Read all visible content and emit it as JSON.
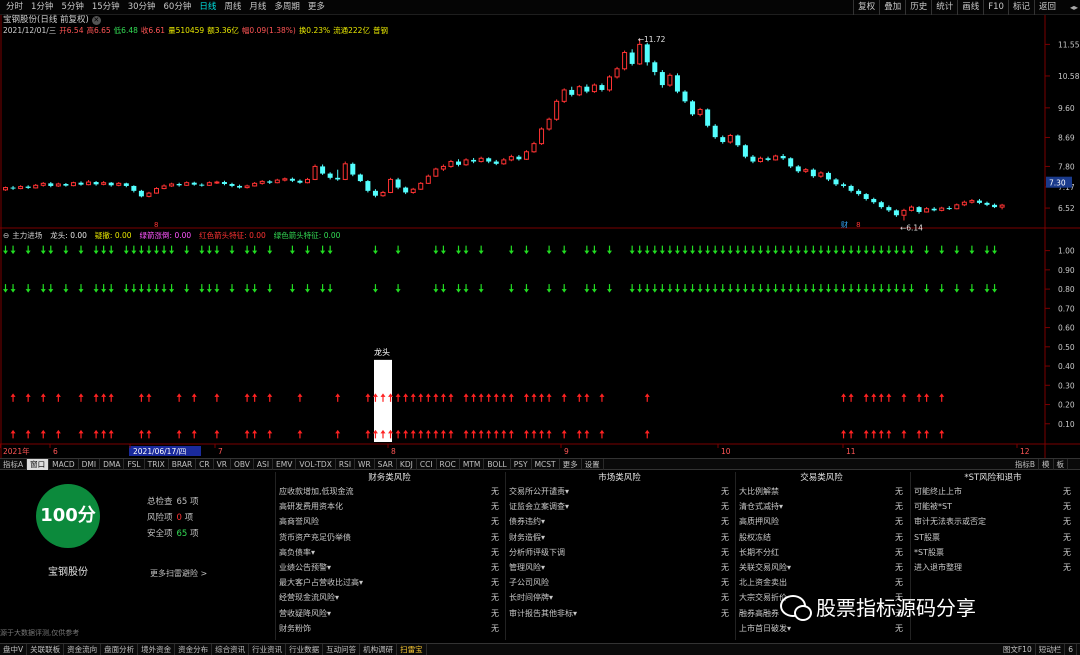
{
  "toolbar": {
    "timeframes": [
      "分时",
      "1分钟",
      "5分钟",
      "15分钟",
      "30分钟",
      "60分钟",
      "日线",
      "周线",
      "月线",
      "多周期",
      "更多"
    ],
    "active_timeframe": "日线",
    "right_buttons": [
      "复权",
      "叠加",
      "历史",
      "统计",
      "画线",
      "F10",
      "标记",
      "返回"
    ],
    "scroll_arrows": "◂▸"
  },
  "stock": {
    "title": "宝钢股份(日线 前复权)",
    "close_icon": "close-icon"
  },
  "info_bar": {
    "date": "2021/12/01/三",
    "open": "开6.54",
    "high": "高6.65",
    "low": "低6.48",
    "close": "收6.61",
    "volume": "量510459",
    "amount": "额3.36亿",
    "change": "幅0.09(1.38%)",
    "turnover": "换0.23%",
    "float_shares": "流通222亿",
    "sector": "普钢"
  },
  "price_axis": {
    "ticks": [
      "11.55",
      "10.58",
      "9.60",
      "8.69",
      "7.80",
      "7.17",
      "6.52"
    ],
    "current_price_tag": "7.30"
  },
  "chart_data": {
    "type": "candlestick",
    "y_range": [
      6.0,
      11.9
    ],
    "candles": [
      [
        7.08,
        7.15,
        7.18,
        7.05
      ],
      [
        7.15,
        7.12,
        7.2,
        7.08
      ],
      [
        7.12,
        7.18,
        7.22,
        7.1
      ],
      [
        7.18,
        7.14,
        7.22,
        7.11
      ],
      [
        7.14,
        7.22,
        7.26,
        7.12
      ],
      [
        7.22,
        7.28,
        7.32,
        7.18
      ],
      [
        7.28,
        7.2,
        7.32,
        7.16
      ],
      [
        7.2,
        7.26,
        7.3,
        7.17
      ],
      [
        7.26,
        7.21,
        7.29,
        7.18
      ],
      [
        7.21,
        7.3,
        7.33,
        7.19
      ],
      [
        7.3,
        7.24,
        7.34,
        7.21
      ],
      [
        7.24,
        7.32,
        7.38,
        7.22
      ],
      [
        7.32,
        7.25,
        7.35,
        7.21
      ],
      [
        7.25,
        7.3,
        7.35,
        7.22
      ],
      [
        7.3,
        7.22,
        7.32,
        7.18
      ],
      [
        7.22,
        7.28,
        7.32,
        7.19
      ],
      [
        7.28,
        7.2,
        7.3,
        7.16
      ],
      [
        7.2,
        7.05,
        7.22,
        7.0
      ],
      [
        7.05,
        6.88,
        7.08,
        6.85
      ],
      [
        6.88,
        6.98,
        7.02,
        6.85
      ],
      [
        6.98,
        7.12,
        7.16,
        6.96
      ],
      [
        7.12,
        7.2,
        7.25,
        7.1
      ],
      [
        7.2,
        7.26,
        7.3,
        7.17
      ],
      [
        7.26,
        7.22,
        7.3,
        7.18
      ],
      [
        7.22,
        7.3,
        7.34,
        7.2
      ],
      [
        7.3,
        7.24,
        7.33,
        7.21
      ],
      [
        7.24,
        7.22,
        7.28,
        7.18
      ],
      [
        7.22,
        7.3,
        7.34,
        7.2
      ],
      [
        7.3,
        7.32,
        7.36,
        7.26
      ],
      [
        7.32,
        7.26,
        7.36,
        7.22
      ],
      [
        7.26,
        7.2,
        7.3,
        7.16
      ],
      [
        7.2,
        7.15,
        7.24,
        7.12
      ],
      [
        7.15,
        7.2,
        7.24,
        7.12
      ],
      [
        7.2,
        7.28,
        7.32,
        7.18
      ],
      [
        7.28,
        7.34,
        7.38,
        7.24
      ],
      [
        7.34,
        7.3,
        7.38,
        7.26
      ],
      [
        7.3,
        7.38,
        7.42,
        7.28
      ],
      [
        7.38,
        7.42,
        7.46,
        7.34
      ],
      [
        7.42,
        7.36,
        7.46,
        7.32
      ],
      [
        7.36,
        7.3,
        7.4,
        7.27
      ],
      [
        7.3,
        7.4,
        7.45,
        7.28
      ],
      [
        7.4,
        7.8,
        7.86,
        7.38
      ],
      [
        7.8,
        7.58,
        7.86,
        7.54
      ],
      [
        7.58,
        7.45,
        7.62,
        7.4
      ],
      [
        7.45,
        7.4,
        7.7,
        7.36
      ],
      [
        7.4,
        7.88,
        7.95,
        7.38
      ],
      [
        7.88,
        7.55,
        7.92,
        7.5
      ],
      [
        7.55,
        7.35,
        7.58,
        7.32
      ],
      [
        7.35,
        7.05,
        7.38,
        7.0
      ],
      [
        7.05,
        6.9,
        7.1,
        6.85
      ],
      [
        6.9,
        7.0,
        7.05,
        6.87
      ],
      [
        7.0,
        7.4,
        7.45,
        6.98
      ],
      [
        7.4,
        7.15,
        7.45,
        7.1
      ],
      [
        7.15,
        7.0,
        7.18,
        6.95
      ],
      [
        7.0,
        7.1,
        7.14,
        6.96
      ],
      [
        7.1,
        7.28,
        7.32,
        7.08
      ],
      [
        7.28,
        7.5,
        7.55,
        7.26
      ],
      [
        7.5,
        7.72,
        7.76,
        7.48
      ],
      [
        7.72,
        7.8,
        7.86,
        7.66
      ],
      [
        7.8,
        7.95,
        8.0,
        7.76
      ],
      [
        7.95,
        7.85,
        8.02,
        7.8
      ],
      [
        7.85,
        8.0,
        8.05,
        7.82
      ],
      [
        8.0,
        7.95,
        8.06,
        7.9
      ],
      [
        7.95,
        8.05,
        8.1,
        7.92
      ],
      [
        8.05,
        7.95,
        8.08,
        7.9
      ],
      [
        7.95,
        7.88,
        8.0,
        7.84
      ],
      [
        7.88,
        8.0,
        8.06,
        7.85
      ],
      [
        8.0,
        8.1,
        8.16,
        7.96
      ],
      [
        8.1,
        8.02,
        8.15,
        7.98
      ],
      [
        8.02,
        8.25,
        8.3,
        8.0
      ],
      [
        8.25,
        8.5,
        8.56,
        8.22
      ],
      [
        8.5,
        8.95,
        9.0,
        8.46
      ],
      [
        8.95,
        9.25,
        9.3,
        8.9
      ],
      [
        9.25,
        9.8,
        9.86,
        9.2
      ],
      [
        9.8,
        10.15,
        10.2,
        9.75
      ],
      [
        10.15,
        10.0,
        10.25,
        9.95
      ],
      [
        10.0,
        10.25,
        10.3,
        9.96
      ],
      [
        10.25,
        10.1,
        10.32,
        10.05
      ],
      [
        10.1,
        10.3,
        10.35,
        10.06
      ],
      [
        10.3,
        10.15,
        10.35,
        10.1
      ],
      [
        10.15,
        10.55,
        10.6,
        10.1
      ],
      [
        10.55,
        10.8,
        10.86,
        10.5
      ],
      [
        10.8,
        11.3,
        11.36,
        10.75
      ],
      [
        11.3,
        10.95,
        11.4,
        10.9
      ],
      [
        10.95,
        11.55,
        11.72,
        10.92
      ],
      [
        11.55,
        11.0,
        11.6,
        10.9
      ],
      [
        11.0,
        10.7,
        11.05,
        10.6
      ],
      [
        10.7,
        10.3,
        10.76,
        10.22
      ],
      [
        10.3,
        10.6,
        10.66,
        10.25
      ],
      [
        10.6,
        10.1,
        10.66,
        10.05
      ],
      [
        10.1,
        9.8,
        10.14,
        9.75
      ],
      [
        9.8,
        9.4,
        9.84,
        9.35
      ],
      [
        9.4,
        9.55,
        9.6,
        9.34
      ],
      [
        9.55,
        9.05,
        9.58,
        9.0
      ],
      [
        9.05,
        8.7,
        9.1,
        8.65
      ],
      [
        8.7,
        8.55,
        8.75,
        8.5
      ],
      [
        8.55,
        8.75,
        8.8,
        8.5
      ],
      [
        8.75,
        8.45,
        8.78,
        8.4
      ],
      [
        8.45,
        8.1,
        8.48,
        8.05
      ],
      [
        8.1,
        7.95,
        8.15,
        7.9
      ],
      [
        7.95,
        8.05,
        8.1,
        7.92
      ],
      [
        8.05,
        8.0,
        8.1,
        7.96
      ],
      [
        8.0,
        8.12,
        8.16,
        7.98
      ],
      [
        8.12,
        8.05,
        8.18,
        8.0
      ],
      [
        8.05,
        7.8,
        8.08,
        7.75
      ],
      [
        7.8,
        7.65,
        7.84,
        7.6
      ],
      [
        7.65,
        7.7,
        7.75,
        7.6
      ],
      [
        7.7,
        7.5,
        7.74,
        7.45
      ],
      [
        7.5,
        7.6,
        7.65,
        7.45
      ],
      [
        7.6,
        7.4,
        7.64,
        7.35
      ],
      [
        7.4,
        7.25,
        7.44,
        7.2
      ],
      [
        7.25,
        7.2,
        7.3,
        7.15
      ],
      [
        7.2,
        7.05,
        7.24,
        7.0
      ],
      [
        7.05,
        6.95,
        7.1,
        6.9
      ],
      [
        6.95,
        6.8,
        6.98,
        6.75
      ],
      [
        6.8,
        6.7,
        6.84,
        6.65
      ],
      [
        6.7,
        6.55,
        6.74,
        6.5
      ],
      [
        6.55,
        6.45,
        6.6,
        6.4
      ],
      [
        6.45,
        6.3,
        6.48,
        6.25
      ],
      [
        6.3,
        6.45,
        6.5,
        6.14
      ],
      [
        6.45,
        6.55,
        6.6,
        6.42
      ],
      [
        6.55,
        6.4,
        6.58,
        6.35
      ],
      [
        6.4,
        6.5,
        6.55,
        6.38
      ],
      [
        6.5,
        6.45,
        6.55,
        6.42
      ],
      [
        6.45,
        6.52,
        6.56,
        6.42
      ],
      [
        6.52,
        6.5,
        6.58,
        6.46
      ],
      [
        6.5,
        6.62,
        6.66,
        6.48
      ],
      [
        6.62,
        6.7,
        6.75,
        6.58
      ],
      [
        6.7,
        6.75,
        6.8,
        6.66
      ],
      [
        6.75,
        6.68,
        6.8,
        6.64
      ],
      [
        6.68,
        6.62,
        6.72,
        6.58
      ],
      [
        6.62,
        6.55,
        6.66,
        6.52
      ],
      [
        6.55,
        6.61,
        6.65,
        6.48
      ]
    ],
    "high_label": "11.72",
    "low_label": "6.14",
    "indicator": {
      "y_range": [
        0,
        1.05
      ],
      "ticks": [
        "1.00",
        "0.90",
        "0.80",
        "0.70",
        "0.60",
        "0.50",
        "0.40",
        "0.30",
        "0.20",
        "0.10"
      ],
      "dragon_label": "龙头",
      "green_arrow_idx": [
        0,
        1,
        3,
        5,
        6,
        8,
        10,
        12,
        13,
        14,
        16,
        17,
        18,
        19,
        20,
        21,
        22,
        24,
        26,
        27,
        28,
        30,
        32,
        33,
        35,
        38,
        40,
        42,
        43,
        49,
        52,
        57,
        58,
        60,
        61,
        63,
        67,
        69,
        72,
        74,
        77,
        78,
        80,
        83,
        84,
        85,
        86,
        87,
        88,
        89,
        90,
        91,
        92,
        93,
        94,
        95,
        96,
        97,
        98,
        99,
        100,
        101,
        102,
        103,
        104,
        105,
        106,
        107,
        108,
        109,
        110,
        111,
        112,
        113,
        114,
        115,
        116,
        117,
        118,
        119,
        120,
        122,
        124,
        126,
        128,
        130,
        131
      ],
      "red_arrow_idx": [
        1,
        3,
        5,
        7,
        10,
        12,
        13,
        14,
        18,
        19,
        23,
        25,
        28,
        32,
        33,
        35,
        39,
        44,
        48,
        49,
        50,
        51,
        52,
        53,
        54,
        55,
        56,
        57,
        58,
        59,
        61,
        62,
        63,
        64,
        65,
        66,
        67,
        69,
        70,
        71,
        72,
        74,
        76,
        77,
        79,
        85,
        111,
        112,
        114,
        115,
        116,
        117,
        119,
        121,
        122,
        124
      ]
    },
    "date_axis": [
      "2021年",
      "6",
      "2021/06/17/四",
      "7",
      "8",
      "9",
      "10",
      "11",
      "12"
    ],
    "markers": [
      "8",
      "8",
      "财"
    ]
  },
  "indicator_bar": {
    "name": "主力进场",
    "dragon": "龙头: 0.00",
    "retreat": "疑撤: 0.00",
    "green_up": "绿箭涨倒: 0.00",
    "red_hint": "红色箭头特征: 0.00",
    "green_hint": "绿色箭头特征: 0.00"
  },
  "bottom_tabs": {
    "items": [
      "指标A",
      "窗口",
      "MACD",
      "DMI",
      "DMA",
      "FSL",
      "TRIX",
      "BRAR",
      "CR",
      "VR",
      "OBV",
      "ASI",
      "EMV",
      "VOL-TDX",
      "RSI",
      "WR",
      "SAR",
      "KDJ",
      "CCI",
      "ROC",
      "MTM",
      "BOLL",
      "PSY",
      "MCST",
      "更多",
      "设置"
    ],
    "active": "窗口",
    "right": [
      "指标B",
      "模",
      "板"
    ]
  },
  "risk": {
    "score": "100分",
    "stock_name": "宝钢股份",
    "total_label": "总检查",
    "total_value": "65",
    "total_unit": "项",
    "risk_label": "风险项",
    "risk_value": "0",
    "risk_unit": "项",
    "safe_label": "安全项",
    "safe_value": "65",
    "safe_unit": "项",
    "more_link": "更多扫雷避险 >",
    "disclaimer": "源于大数据评测,仅供参考",
    "columns": [
      {
        "title": "财务类风险",
        "items": [
          [
            "应收款增加,低现金流",
            "无"
          ],
          [
            "高研发费用资本化",
            "无"
          ],
          [
            "高商誉风险",
            "无"
          ],
          [
            "货币资产充足仍举债",
            "无"
          ],
          [
            "高负债率▾",
            "无"
          ],
          [
            "业绩公告预警▾",
            "无"
          ],
          [
            "最大客户占营收比过高▾",
            "无"
          ],
          [
            "经营现金流风险▾",
            "无"
          ],
          [
            "营收疑降风险▾",
            "无"
          ],
          [
            "财务粉饰",
            "无"
          ]
        ]
      },
      {
        "title": "市场类风险",
        "items": [
          [
            "交易所公开谴责▾",
            "无"
          ],
          [
            "证监会立案调查▾",
            "无"
          ],
          [
            "债券违约▾",
            "无"
          ],
          [
            "财务造假▾",
            "无"
          ],
          [
            "分析师评级下调",
            "无"
          ],
          [
            "管理风险▾",
            "无"
          ],
          [
            "子公司风险",
            "无"
          ],
          [
            "长时间停牌▾",
            "无"
          ],
          [
            "审计报告其他非标▾",
            "无"
          ]
        ]
      },
      {
        "title": "交易类风险",
        "items": [
          [
            "大比例解禁",
            "无"
          ],
          [
            "清仓式减持▾",
            "无"
          ],
          [
            "高质押风险",
            "无"
          ],
          [
            "股权冻结",
            "无"
          ],
          [
            "长期不分红",
            "无"
          ],
          [
            "关联交易风险▾",
            "无"
          ],
          [
            "北上资金卖出",
            "无"
          ],
          [
            "大宗交易折价",
            "无"
          ],
          [
            "融券高融券",
            "无"
          ],
          [
            "上市首日破发▾",
            "无"
          ]
        ]
      },
      {
        "title": "*ST风险和退市",
        "items": [
          [
            "可能终止上市",
            "无"
          ],
          [
            "可能被*ST",
            "无"
          ],
          [
            "审计无法表示或否定",
            "无"
          ],
          [
            "ST股票",
            "无"
          ],
          [
            "*ST股票",
            "无"
          ],
          [
            "进入退市整理",
            "无"
          ]
        ]
      }
    ]
  },
  "watermark": "股票指标源码分享",
  "status_bar": {
    "items": [
      "盘中V",
      "关联联板",
      "资金流向",
      "盘面分析",
      "境外资金",
      "资金分布",
      "综合资讯",
      "行业资讯",
      "行业数据",
      "互动问答",
      "机构调研",
      "扫雷宝"
    ],
    "right": [
      "图文F10",
      "短动栏",
      "6"
    ]
  },
  "colors": {
    "up": "#ff3333",
    "down": "#54ffff",
    "green_arrow": "#22dd22",
    "red_arrow": "#ff2222",
    "axis": "#7a0000",
    "tick_text": "#c8c8c8"
  }
}
